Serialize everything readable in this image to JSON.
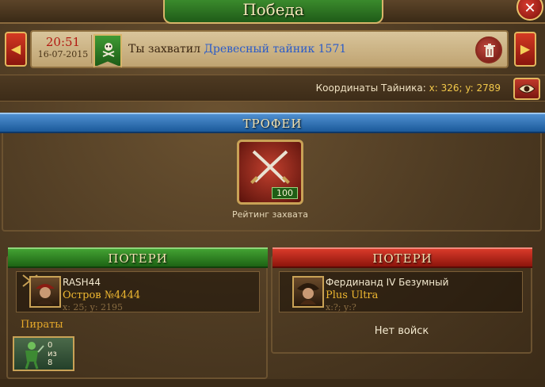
{
  "window": {
    "title": "Победа"
  },
  "message": {
    "time": "20:51",
    "date": "16-07-2015",
    "text_prefix": "Ты захватил",
    "link_text": "Древесный тайник 1571"
  },
  "coordinates": {
    "label": "Координаты Тайника:",
    "value": "x: 326; y: 2789"
  },
  "trophies": {
    "title": "ТРОФЕИ",
    "item": {
      "count": "100",
      "label": "Рейтинг захвата",
      "icon": "crossed-sabers-icon"
    }
  },
  "losses_left": {
    "title": "ПОТЕРИ",
    "player": {
      "name": "RASH44",
      "island": "Остров №4444",
      "coords": "x: 25; y: 2195"
    },
    "section_label": "Пираты",
    "unit": {
      "count_line1": "0",
      "count_line2": "из",
      "count_line3": "8"
    }
  },
  "losses_right": {
    "title": "ПОТЕРИ",
    "player": {
      "name": "Фердинанд IV Безумный",
      "alliance": "Plus Ultra",
      "coords": "x:?; y:?"
    },
    "empty_text": "Нет войск"
  },
  "colors": {
    "accent_green": "#2f7d22",
    "accent_blue": "#2a6cb0",
    "accent_red": "#b32619",
    "gold_text": "#efb831"
  }
}
